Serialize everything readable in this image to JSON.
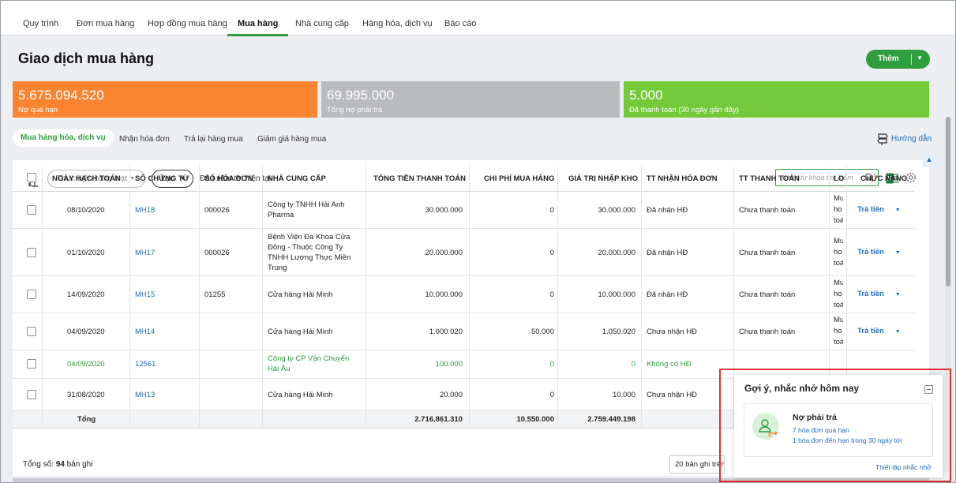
{
  "topnav": {
    "tabs": [
      {
        "label": "Quy trình"
      },
      {
        "label": "Đơn mua hàng"
      },
      {
        "label": "Hợp đồng mua hàng"
      },
      {
        "label": "Mua hàng"
      },
      {
        "label": "Nhà cung cấp"
      },
      {
        "label": "Hàng hóa, dịch vụ"
      },
      {
        "label": "Báo cáo"
      }
    ],
    "active": "Mua hàng"
  },
  "header": {
    "title": "Giao dịch mua hàng",
    "add_label": "Thêm",
    "add_dropdown_icon": "chevron-down-icon"
  },
  "summary_cards": [
    {
      "value": "5.675.094.520",
      "label": "Nợ quá hạn",
      "color": "#fb8431"
    },
    {
      "value": "69.995.000",
      "label": "Tổng nợ phải trả",
      "color": "#b9bbbe"
    },
    {
      "value": "5.000",
      "label": "Đã thanh toán (30 ngày gần đây)",
      "color": "#74c93a"
    }
  ],
  "subtabs": [
    {
      "label": "Mua hàng hóa, dịch vụ"
    },
    {
      "label": "Nhận hóa đơn"
    },
    {
      "label": "Trả lại hàng mua"
    },
    {
      "label": "Giảm giá hàng mua"
    }
  ],
  "guide_label": "Hướng dẫn",
  "toolbar": {
    "bulk_label": "Thực hiện hàng loạt",
    "filter_label": "Lọc",
    "period_label": "Đầu năm tới hiện tại",
    "search_placeholder": "Nhập từ khóa tìm kiếm"
  },
  "table": {
    "columns": [
      "NGÀY HẠCH TOÁN",
      "SỐ CHỨNG TỪ",
      "SỐ HÓA ĐƠN",
      "NHÀ CUNG CẤP",
      "TỔNG TIỀN THANH TOÁN",
      "CHI PHÍ MUA HÀNG",
      "GIÁ TRỊ NHẬP KHO",
      "TT NHẬN HÓA ĐƠN",
      "TT THANH TOÁN",
      "LO",
      "CHỨC NĂNG"
    ],
    "rows": [
      {
        "date": "08/10/2020",
        "doc": "MH18",
        "invoice": "000026",
        "supplier": "Công ty TNHH Hải Anh Pharma",
        "total": "30.000.000",
        "cost": "0",
        "stock": "30.000.000",
        "inv_status": "Đã nhận HĐ",
        "pay_status": "Chưa thanh toán",
        "lo": "Mu ho toá",
        "action": "Trả tiền"
      },
      {
        "date": "01/10/2020",
        "doc": "MH17",
        "invoice": "000026",
        "supplier": "Bệnh Viện Đa Khoa Cửa Đông - Thuộc Công Ty TNHH Lương Thực Miền Trung",
        "total": "20.000.000",
        "cost": "0",
        "stock": "20.000.000",
        "inv_status": "Đã nhận HĐ",
        "pay_status": "Chưa thanh toán",
        "lo": "Mu ho toá",
        "action": "Trả tiền"
      },
      {
        "date": "14/09/2020",
        "doc": "MH15",
        "invoice": "01255",
        "supplier": "Cửa hàng Hải Minh",
        "total": "10.000.000",
        "cost": "0",
        "stock": "10.000.000",
        "inv_status": "Đã nhận HĐ",
        "pay_status": "Chưa thanh toán",
        "lo": "Mu ho toá",
        "action": "Trả tiền"
      },
      {
        "date": "04/09/2020",
        "doc": "MH14",
        "invoice": "",
        "supplier": "Cửa hàng Hải Minh",
        "total": "1.000.020",
        "cost": "50.000",
        "stock": "1.050.020",
        "inv_status": "Chưa nhận HĐ",
        "pay_status": "Chưa thanh toán",
        "lo": "Mu ho toá",
        "action": "Trả tiền"
      },
      {
        "date": "04/09/2020",
        "doc": "12561",
        "invoice": "",
        "supplier": "Công ty CP Vận Chuyển Hải Âu",
        "total": "100.000",
        "cost": "0",
        "stock": "0",
        "inv_status": "Không có HĐ",
        "pay_status": "",
        "lo": "",
        "action": ""
      },
      {
        "date": "31/08/2020",
        "doc": "MH13",
        "invoice": "",
        "supplier": "Cửa hàng Hải Minh",
        "total": "20.000",
        "cost": "0",
        "stock": "10.000",
        "inv_status": "Chưa nhận HĐ",
        "pay_status": "",
        "lo": "",
        "action": ""
      }
    ],
    "totals": {
      "label": "Tổng",
      "total": "2.716.861.310",
      "cost": "10.550.000",
      "stock": "2.759.449.198"
    }
  },
  "footer": {
    "count_prefix": "Tổng số:",
    "count": "94",
    "count_suffix": "bản ghi",
    "pager": "20 bản ghi trên 1 trang"
  },
  "reminder": {
    "title": "Gợi ý, nhắc nhở hôm nay",
    "item_title": "Nợ phải trả",
    "line1": "7 hóa đơn quá hạn",
    "line2": "1 hóa đơn đến hạn trong 30 ngày tới",
    "setup": "Thiết lập nhắc nhở"
  },
  "colors": {
    "accent": "#2e9e3e",
    "link": "#1e6bb8",
    "highlight": "#e0302f"
  }
}
